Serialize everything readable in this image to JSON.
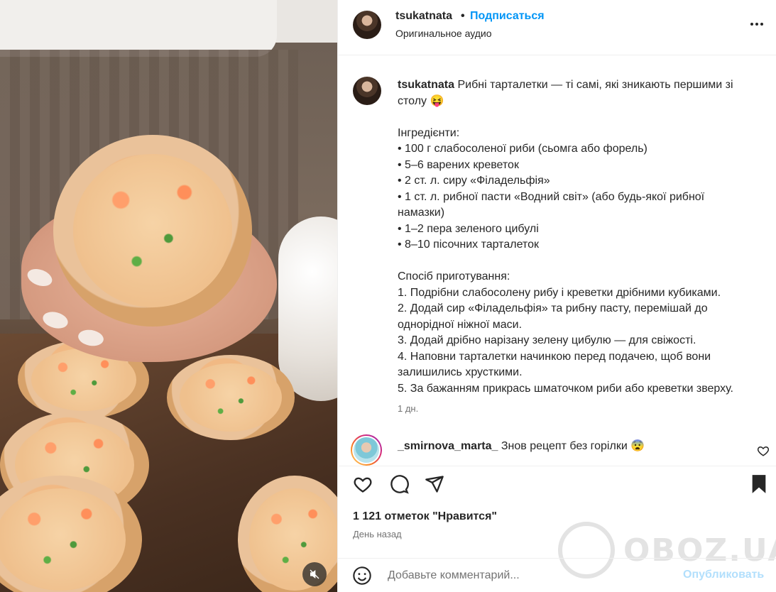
{
  "header": {
    "username": "tsukatnata",
    "separator": "•",
    "follow_label": "Подписаться",
    "audio_label": "Оригинальное аудио",
    "more_icon": "more-horizontal-icon"
  },
  "caption": {
    "username": "tsukatnata",
    "first_line": "Рибні тарталетки — ті самі, які зникають першими зі",
    "second_line": "столу 😝",
    "lines": [
      "",
      "Інгредієнти:",
      "• 100 г слабосоленої риби (сьомга або форель)",
      "• 5–6 варених креветок",
      "• 2 ст. л. сиру «Філадельфія»",
      "• 1 ст. л. рибної пасти «Водний світ» (або будь-якої рибної",
      "намазки)",
      "• 1–2 пера зеленого цибулі",
      "• 8–10 пісочних тарталеток",
      "",
      "Спосіб приготування:",
      "1. Подрібни слабосолену рибу і креветки дрібними кубиками.",
      "2. Додай сир «Філадельфія» та рибну пасту, перемішай до",
      "однорідної ніжної маси.",
      "3. Додай дрібно нарізану зелену цибулю — для свіжості.",
      "4. Наповни тарталетки начинкою перед подачею, щоб вони",
      "залишились хрусткими.",
      "5. За бажанням прикрась шматочком риби або креветки зверху."
    ],
    "time": "1 дн."
  },
  "comment": {
    "username": "_smirnova_marta_",
    "text": "Знов рецепт без горілки 😨"
  },
  "actions": {
    "likes": "1 121 отметок \"Нравится\"",
    "posted": "День назад"
  },
  "composer": {
    "placeholder": "Добавьте комментарий...",
    "publish_label": "Опубликовать"
  },
  "watermark": {
    "text": "OBOZ.UA"
  },
  "colors": {
    "link_blue": "#0095f6",
    "publish_disabled": "#b2dffc",
    "muted_text": "#737373"
  }
}
